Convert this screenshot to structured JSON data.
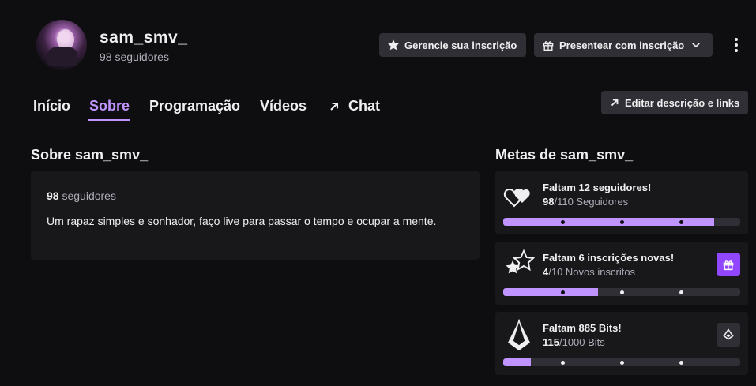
{
  "channel": {
    "name": "sam_smv_",
    "followers_text": "98 seguidores"
  },
  "header_actions": {
    "manage_label": "Gerencie sua inscrição",
    "gift_label": "Presentear com inscrição",
    "manage_icon": "star-icon",
    "gift_icon": "gift-icon",
    "menu_icon": "more-vertical-icon"
  },
  "tabs": [
    {
      "label": "Início",
      "active": false
    },
    {
      "label": "Sobre",
      "active": true
    },
    {
      "label": "Programação",
      "active": false
    },
    {
      "label": "Vídeos",
      "active": false
    },
    {
      "label": "Chat",
      "active": false,
      "icon": "external-arrow-icon"
    }
  ],
  "edit_button": {
    "label": "Editar descrição e links",
    "icon": "external-arrow-icon"
  },
  "about": {
    "title": "Sobre sam_smv_",
    "followers_count": "98",
    "followers_label": "seguidores",
    "description": "Um rapaz simples e sonhador, faço live para passar o tempo e ocupar a mente."
  },
  "goals": {
    "title": "Metas de sam_smv_",
    "items": [
      {
        "name": "Faltam 12 seguidores!",
        "current": "98",
        "target": "/110 Seguidores",
        "fraction": 0.89,
        "icon": "hearts-icon"
      },
      {
        "name": "Faltam 6 inscrições novas!",
        "current": "4",
        "target": "/10 Novos inscritos",
        "fraction": 0.4,
        "icon": "stars-icon",
        "action_icon": "gift-icon"
      },
      {
        "name": "Faltam 885 Bits!",
        "current": "115",
        "target": "/1000 Bits",
        "fraction": 0.115,
        "icon": "bits-gem-icon",
        "action_icon": "bits-icon"
      }
    ]
  },
  "colors": {
    "accent": "#bf94ff",
    "gift_button": "#9147ff",
    "background": "#0e0e10",
    "card": "#18181b"
  }
}
